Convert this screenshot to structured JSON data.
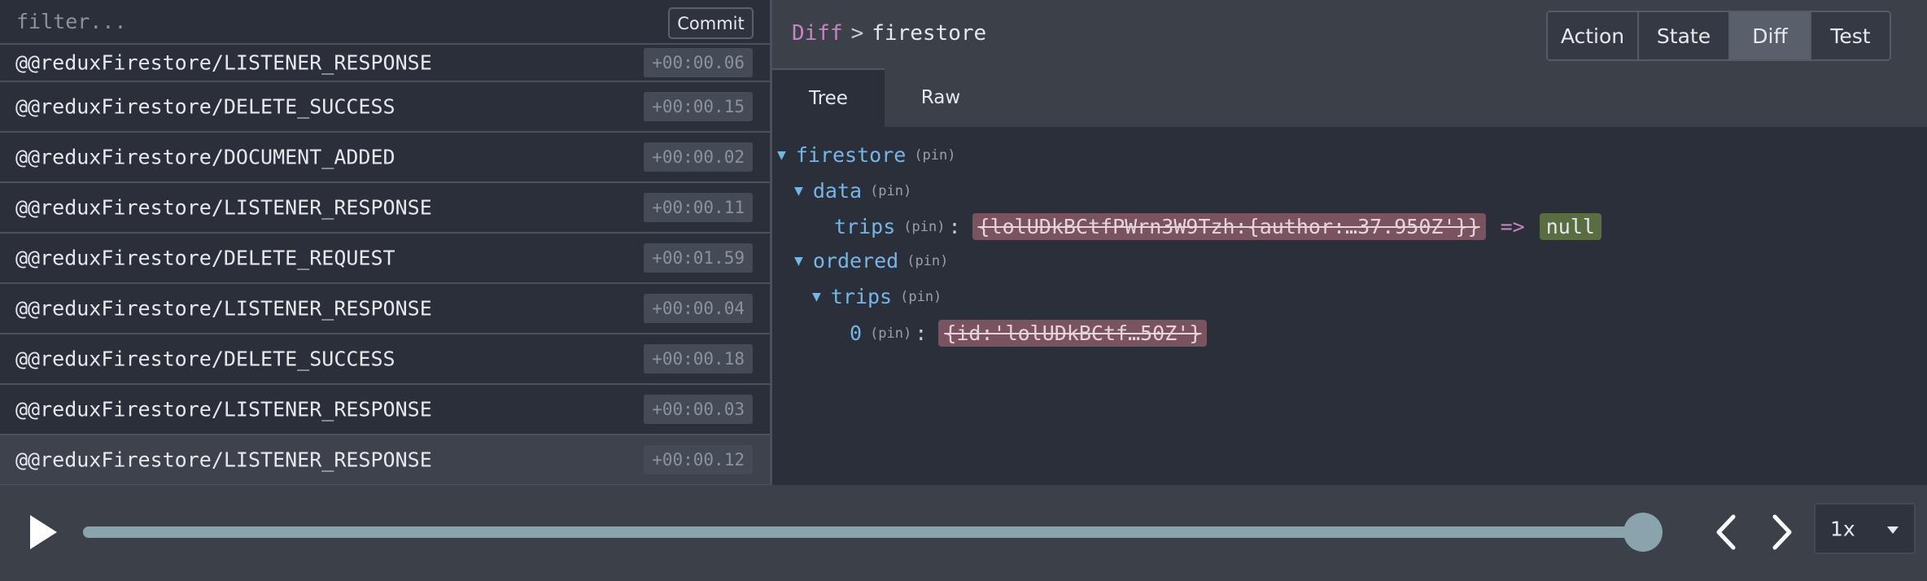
{
  "filter": {
    "placeholder": "filter...",
    "commit_label": "Commit"
  },
  "actions": [
    {
      "name": "@@reduxFirestore/LISTENER_RESPONSE",
      "time": "+00:00.06"
    },
    {
      "name": "@@reduxFirestore/DELETE_SUCCESS",
      "time": "+00:00.15"
    },
    {
      "name": "@@reduxFirestore/DOCUMENT_ADDED",
      "time": "+00:00.02"
    },
    {
      "name": "@@reduxFirestore/LISTENER_RESPONSE",
      "time": "+00:00.11"
    },
    {
      "name": "@@reduxFirestore/DELETE_REQUEST",
      "time": "+00:01.59"
    },
    {
      "name": "@@reduxFirestore/LISTENER_RESPONSE",
      "time": "+00:00.04"
    },
    {
      "name": "@@reduxFirestore/DELETE_SUCCESS",
      "time": "+00:00.18"
    },
    {
      "name": "@@reduxFirestore/LISTENER_RESPONSE",
      "time": "+00:00.03"
    },
    {
      "name": "@@reduxFirestore/LISTENER_RESPONSE",
      "time": "+00:00.12",
      "selected": true
    }
  ],
  "breadcrumb": {
    "section": "Diff",
    "separator": ">",
    "current": "firestore"
  },
  "mode_tabs": [
    {
      "label": "Action"
    },
    {
      "label": "State"
    },
    {
      "label": "Diff",
      "active": true
    },
    {
      "label": "Test"
    }
  ],
  "subtabs": [
    {
      "label": "Tree",
      "active": true
    },
    {
      "label": "Raw"
    }
  ],
  "tree": {
    "root_key": "firestore",
    "pin_label": "(pin)",
    "data_key": "data",
    "trips_key": "trips",
    "trips_old_value": "{lolUDkBCtfPWrn3W9Tzh:{author:…37.950Z'}}",
    "diff_arrow": "=>",
    "trips_new_value": "null",
    "ordered_key": "ordered",
    "ordered_trips_key": "trips",
    "index_key": "0",
    "index_old_value": "{id:'lolUDkBCtf…50Z'}"
  },
  "player": {
    "speed": "1x",
    "progress": 0.988
  },
  "colors": {
    "background": "#2a2f3a",
    "panel": "#3b4049",
    "tree_key": "#76b6e6",
    "removed_bg": "#7a5360",
    "added_bg": "#5a6c41",
    "diff_accent": "#c585c0",
    "slider": "#8aa4ae"
  },
  "icons": {
    "play": "play-icon",
    "prev": "chevron-left-icon",
    "next": "chevron-right-icon",
    "caret": "chevron-down-icon"
  }
}
